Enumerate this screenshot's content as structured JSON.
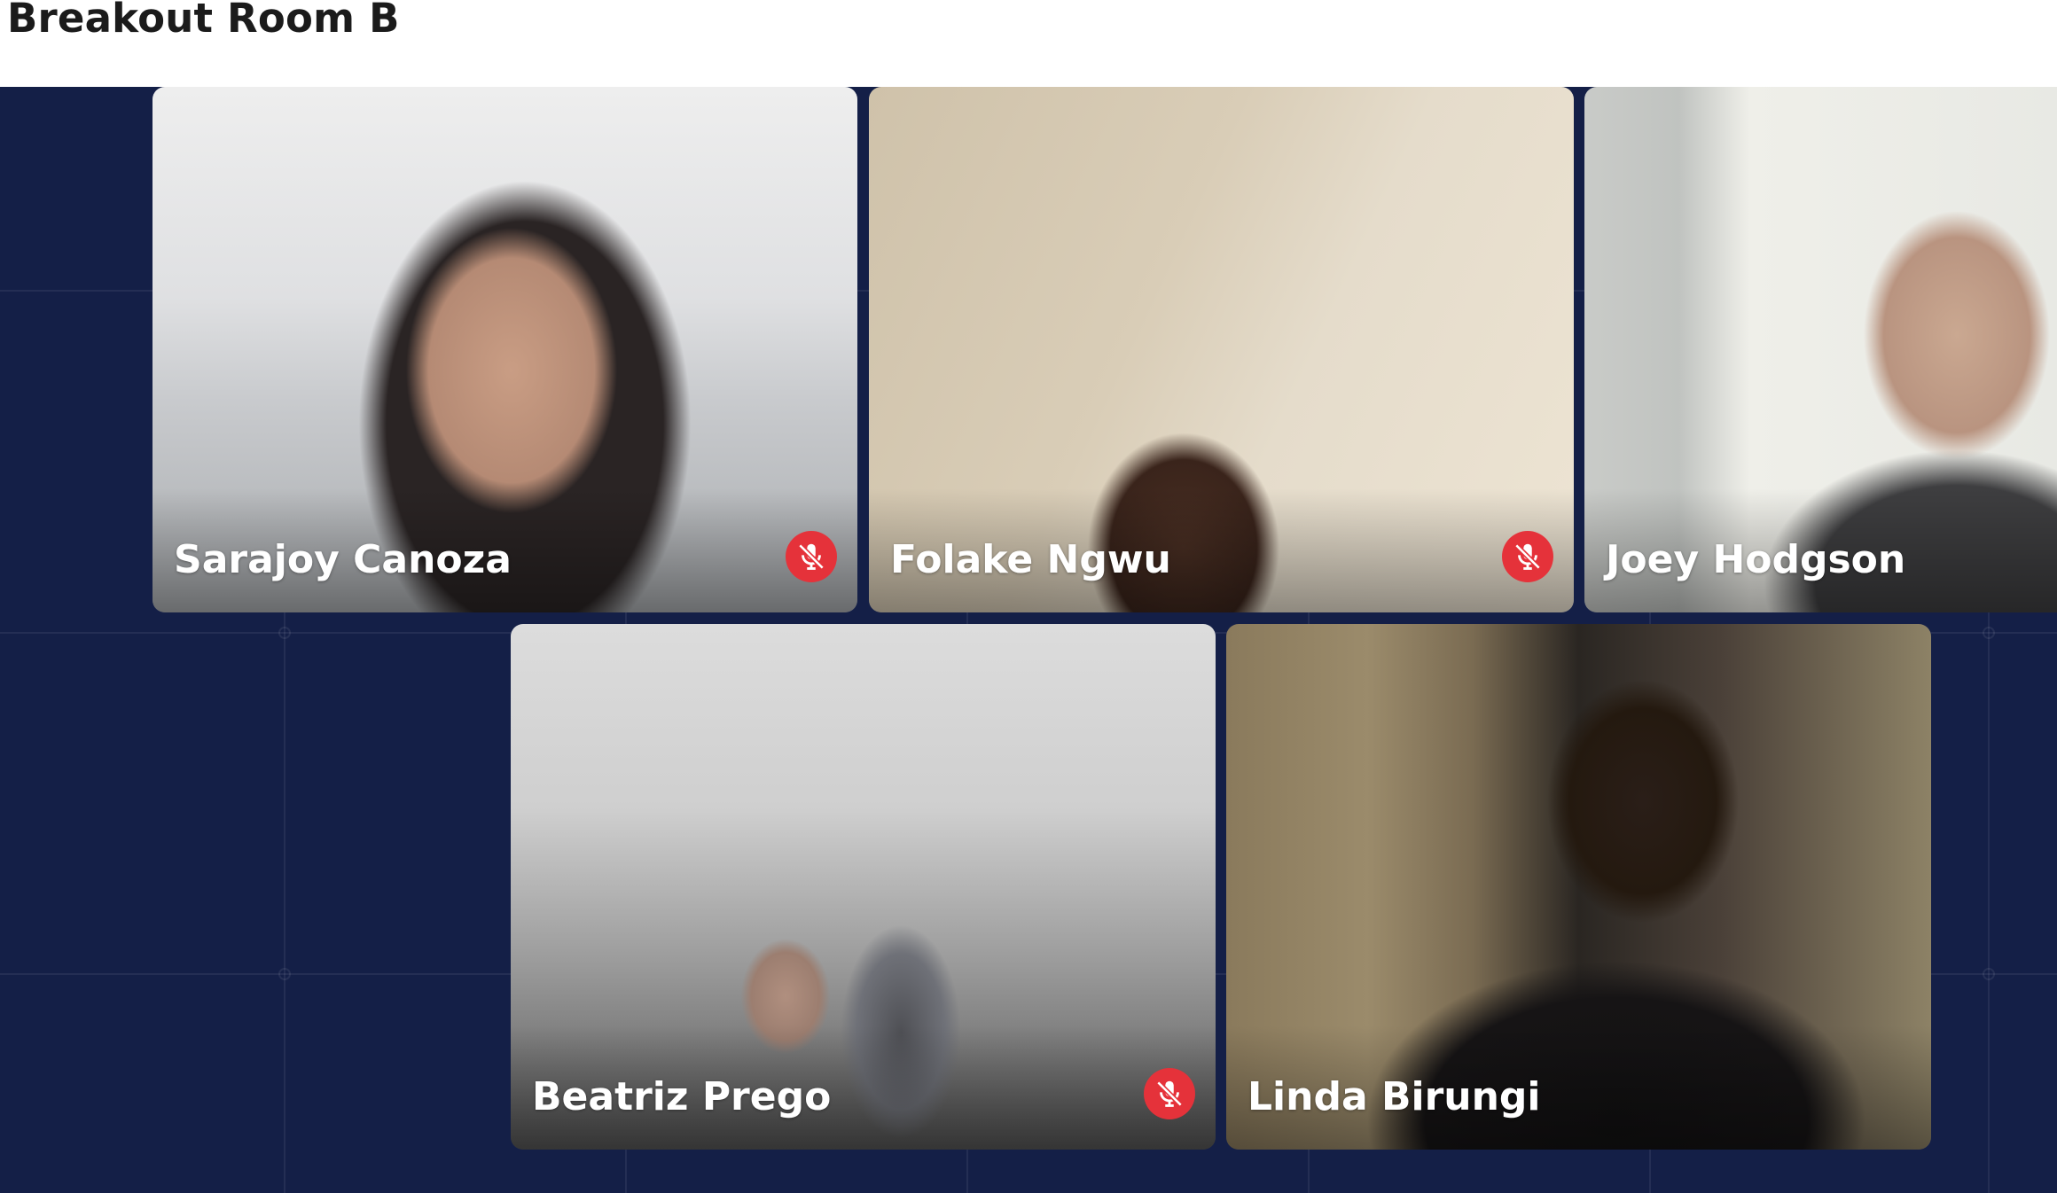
{
  "header": {
    "title": "Breakout Room B"
  },
  "colors": {
    "stage_background": "#141f47",
    "mute_badge": "#e5323a",
    "name_text": "#ffffff"
  },
  "participants": [
    {
      "name": "Sarajoy Canoza",
      "muted": true,
      "icon": "mic-muted-icon"
    },
    {
      "name": "Folake Ngwu",
      "muted": true,
      "icon": "mic-muted-icon"
    },
    {
      "name": "Joey Hodgson",
      "muted": false
    },
    {
      "name": "Beatriz Prego",
      "muted": true,
      "icon": "mic-muted-icon"
    },
    {
      "name": "Linda Birungi",
      "muted": false
    }
  ]
}
